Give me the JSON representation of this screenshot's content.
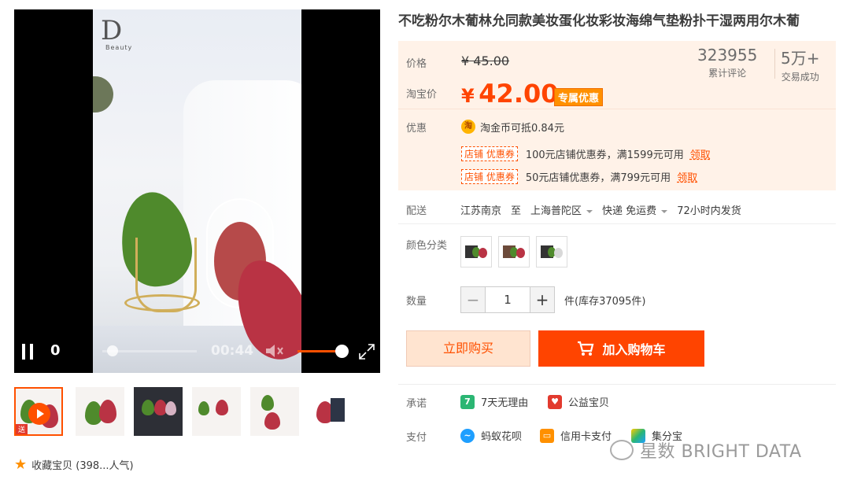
{
  "product": {
    "title": "不吃粉尔木葡林允同款美妆蛋化妆彩妆海绵气垫粉扑干湿两用尔木葡"
  },
  "player": {
    "time_current": "0",
    "duration": "00:44",
    "progress_fraction": 0.05,
    "volume_fraction": 0.9,
    "logo_text": "D",
    "logo_sub": "Beauty"
  },
  "thumbnails": [
    {
      "tag": "送",
      "active": true
    },
    {
      "active": false
    },
    {
      "active": false
    },
    {
      "active": false
    },
    {
      "active": false
    },
    {
      "active": false
    }
  ],
  "favorite": {
    "label": "收藏宝贝 (398...人气)"
  },
  "price": {
    "orig_label": "价格",
    "orig_value": "¥ 45.00",
    "tb_label": "淘宝价",
    "currency": "¥",
    "tb_value": "42.00",
    "special_tag": "专属优惠"
  },
  "stats": {
    "reviews_value": "323955",
    "reviews_label": "累计评论",
    "deals_value": "5万+",
    "deals_label": "交易成功"
  },
  "promo": {
    "label": "优惠",
    "coin_icon": "淘",
    "coin_text": "淘金币可抵0.84元",
    "coupons": [
      {
        "tag": "店铺 优惠券",
        "text": "100元店铺优惠券，满1599元可用",
        "claim": "领取"
      },
      {
        "tag": "店铺 优惠券",
        "text": "50元店铺优惠券，满799元可用",
        "claim": "领取"
      }
    ]
  },
  "shipping": {
    "label": "配送",
    "from": "江苏南京",
    "to_word": "至",
    "to": "上海普陀区",
    "method": "快递 免运费",
    "time": "72小时内发货"
  },
  "sku": {
    "label": "颜色分类"
  },
  "quantity": {
    "label": "数量",
    "minus": "−",
    "value": "1",
    "plus": "+",
    "stock": "件(库存37095件)"
  },
  "actions": {
    "buy": "立即购买",
    "cart": "加入购物车"
  },
  "commitment": {
    "label": "承诺",
    "items": [
      {
        "icon": "7",
        "text": "7天无理由",
        "color": "#2bb673"
      },
      {
        "icon": "",
        "text": "公益宝贝",
        "color": "#e23a2e"
      }
    ]
  },
  "payment": {
    "label": "支付",
    "items": [
      {
        "text": "蚂蚁花呗",
        "color": "#1e9fff"
      },
      {
        "text": "信用卡支付",
        "color": "#ff9000"
      },
      {
        "text": "集分宝",
        "color": "#ffcc00"
      }
    ]
  },
  "watermark": {
    "text": "星数 BRIGHT DATA"
  },
  "colors": {
    "accent": "#ff5000",
    "price": "#ff4400",
    "panel": "#fff2e8"
  }
}
